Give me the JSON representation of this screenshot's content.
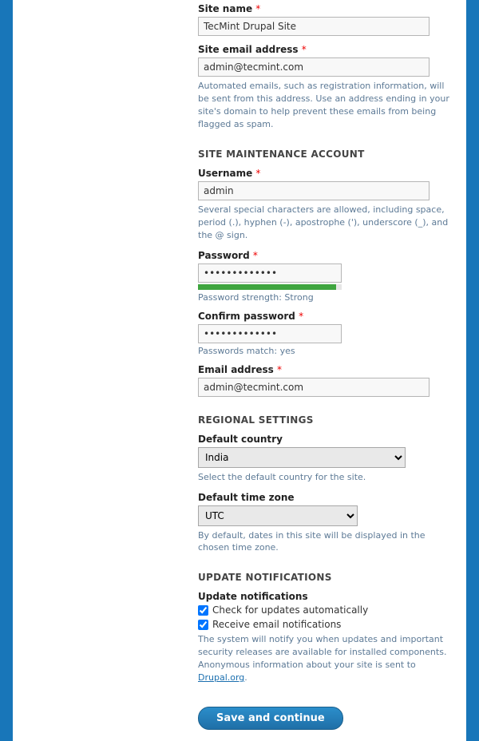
{
  "site": {
    "name_label": "Site name",
    "name_value": "TecMint Drupal Site",
    "email_label": "Site email address",
    "email_value": "admin@tecmint.com",
    "email_desc": "Automated emails, such as registration information, will be sent from this address. Use an address ending in your site's domain to help prevent these emails from being flagged as spam."
  },
  "maint": {
    "section": "SITE MAINTENANCE ACCOUNT",
    "username_label": "Username",
    "username_value": "admin",
    "username_desc": "Several special characters are allowed, including space, period (.), hyphen (-), apostrophe ('), underscore (_), and the @ sign.",
    "password_label": "Password",
    "password_value": "•••••••••••••",
    "strength_label": "Password strength:",
    "strength_value": "Strong",
    "confirm_label": "Confirm password",
    "confirm_value": "•••••••••••••",
    "match_label": "Passwords match:",
    "match_value": "yes",
    "email_label": "Email address",
    "email_value": "admin@tecmint.com"
  },
  "regional": {
    "section": "REGIONAL SETTINGS",
    "country_label": "Default country",
    "country_value": "India",
    "country_desc": "Select the default country for the site.",
    "tz_label": "Default time zone",
    "tz_value": "UTC",
    "tz_desc": "By default, dates in this site will be displayed in the chosen time zone."
  },
  "updates": {
    "section": "UPDATE NOTIFICATIONS",
    "title": "Update notifications",
    "check1": "Check for updates automatically",
    "check1_checked": true,
    "check2": "Receive email notifications",
    "check2_checked": true,
    "desc_pre": "The system will notify you when updates and important security releases are available for installed components. Anonymous information about your site is sent to ",
    "desc_link": "Drupal.org",
    "desc_post": "."
  },
  "submit": "Save and continue"
}
